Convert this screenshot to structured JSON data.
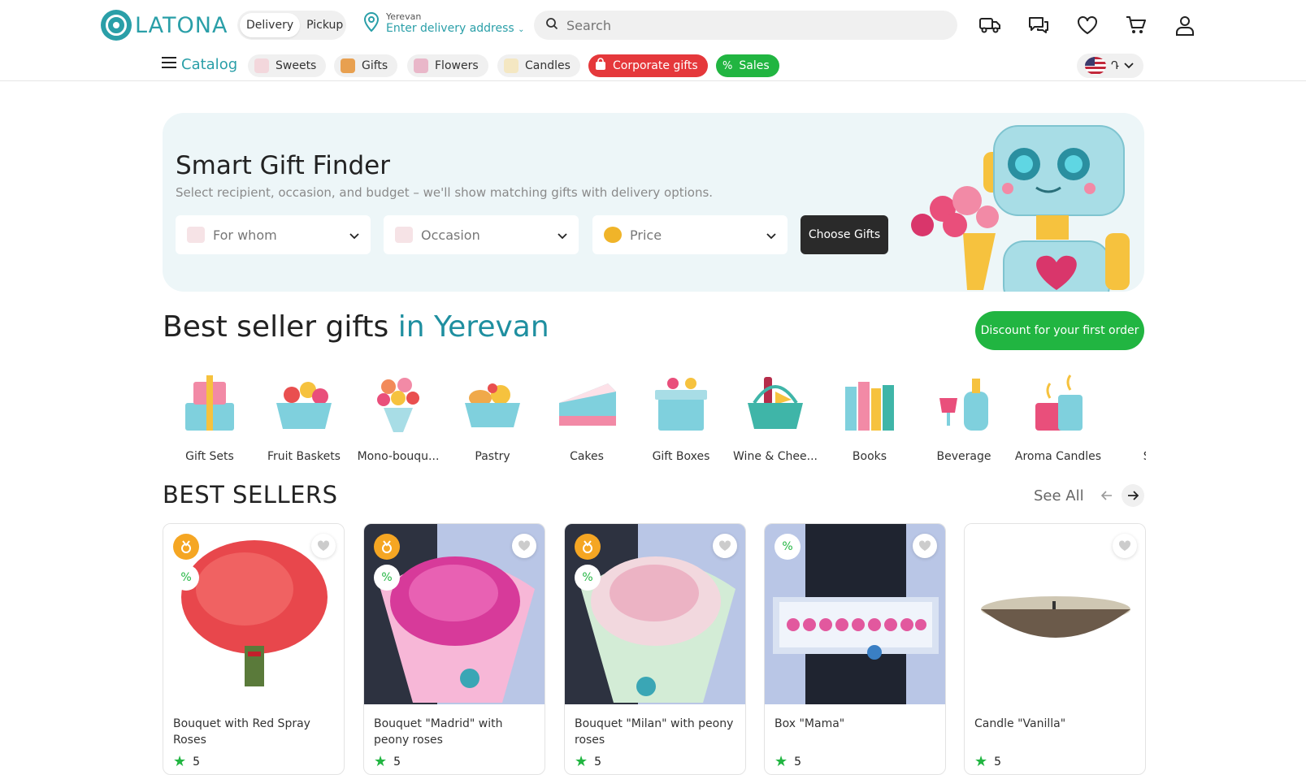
{
  "brand": {
    "name": "LATONA"
  },
  "header": {
    "delivery_label": "Delivery",
    "pickup_label": "Pickup",
    "city": "Yerevan",
    "address_prompt": "Enter delivery address",
    "search_placeholder": "Search"
  },
  "nav": {
    "catalog_label": "Catalog",
    "chips": [
      {
        "label": "Sweets"
      },
      {
        "label": "Gifts"
      },
      {
        "label": "Flowers"
      },
      {
        "label": "Candles"
      },
      {
        "label": "Corporate gifts"
      },
      {
        "label": "Sales"
      }
    ],
    "lang_label": "Դ"
  },
  "finder": {
    "title": "Smart Gift Finder",
    "subtitle": "Select recipient, occasion, and budget – we'll show matching gifts with delivery options.",
    "for_whom": "For whom",
    "occasion": "Occasion",
    "price": "Price",
    "choose_label": "Choose Gifts"
  },
  "bestgifts": {
    "title_part1": "Best seller gifts",
    "title_part2": "in Yerevan",
    "discount_label": "Discount for your first order"
  },
  "categories": [
    {
      "label": "Gift Sets"
    },
    {
      "label": "Fruit Baskets"
    },
    {
      "label": "Mono-bouqu..."
    },
    {
      "label": "Pastry"
    },
    {
      "label": "Cakes"
    },
    {
      "label": "Gift Boxes"
    },
    {
      "label": "Wine & Chee..."
    },
    {
      "label": "Books"
    },
    {
      "label": "Beverage"
    },
    {
      "label": "Aroma Candles"
    },
    {
      "label": "Sof"
    }
  ],
  "bestsellers": {
    "title": "BEST SELLERS",
    "see_all": "See All",
    "products": [
      {
        "name": "Bouquet with Red Spray Roses",
        "rating": "5"
      },
      {
        "name": "Bouquet \"Madrid\" with peony roses",
        "rating": "5"
      },
      {
        "name": "Bouquet \"Milan\" with peony roses",
        "rating": "5"
      },
      {
        "name": "Box \"Mama\"",
        "rating": "5"
      },
      {
        "name": "Candle \"Vanilla\"",
        "rating": "5"
      }
    ]
  },
  "colors": {
    "brand": "#2a9fa8",
    "red": "#e5383b",
    "green": "#21b541",
    "dark": "#2a2a2a"
  }
}
